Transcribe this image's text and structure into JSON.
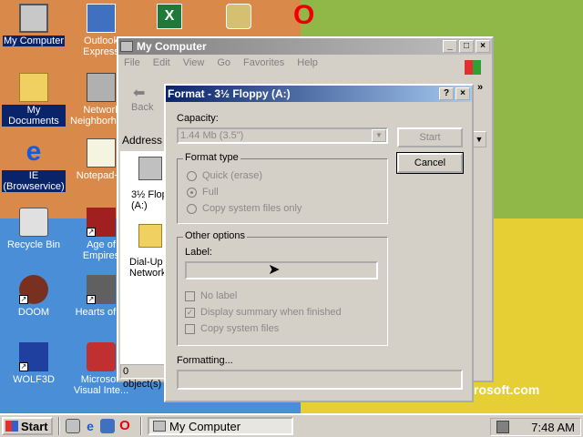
{
  "desktop": {
    "brand_text": "rosoft.com",
    "icons": [
      {
        "label": "My Computer",
        "icon": "computer-icon",
        "selected": true
      },
      {
        "label": "Outlook Express",
        "icon": "outlook-icon"
      },
      {
        "label": "My Documents",
        "icon": "folder-icon",
        "selected": true
      },
      {
        "label": "Network Neighborhood",
        "icon": "network-icon"
      },
      {
        "label": "IE (Browservice)",
        "icon": "internet-explorer-icon",
        "selected": true
      },
      {
        "label": "Notepad++",
        "icon": "notepad-icon"
      },
      {
        "label": "Recycle Bin",
        "icon": "recycle-bin-icon"
      },
      {
        "label": "Age of Empires",
        "icon": "age-of-empires-icon"
      },
      {
        "label": "DOOM",
        "icon": "doom-icon"
      },
      {
        "label": "Hearts of ...",
        "icon": "hearts-of-iron-icon"
      },
      {
        "label": "WOLF3D",
        "icon": "wolf3d-icon"
      },
      {
        "label": "Microsoft Visual Inte...",
        "icon": "visual-interdev-icon"
      }
    ],
    "top_icons": [
      "excel-icon",
      "outlook-express-2-icon",
      "opera-icon"
    ]
  },
  "my_computer": {
    "title": "My Computer",
    "menu": [
      "File",
      "Edit",
      "View",
      "Go",
      "Favorites",
      "Help"
    ],
    "back_label": "Back",
    "address_label": "Address",
    "items": [
      {
        "label": "3½ Flop (A:)",
        "icon": "floppy-drive-icon"
      },
      {
        "label": "Dial-Up Network",
        "icon": "dial-up-networking-icon"
      }
    ],
    "status_text": "0 object(s)"
  },
  "format_dialog": {
    "title": "Format - 3½ Floppy (A:)",
    "capacity_label": "Capacity:",
    "capacity_value": "1.44 Mb (3.5\")",
    "start_label": "Start",
    "cancel_label": "Cancel",
    "format_type": {
      "title": "Format type",
      "options": [
        {
          "label": "Quick (erase)",
          "selected": false
        },
        {
          "label": "Full",
          "selected": true
        },
        {
          "label": "Copy system files only",
          "selected": false
        }
      ]
    },
    "other_options": {
      "title": "Other options",
      "label_label": "Label:",
      "label_value": "",
      "checks": [
        {
          "label": "No label",
          "checked": false
        },
        {
          "label": "Display summary when finished",
          "checked": true
        },
        {
          "label": "Copy system files",
          "checked": false
        }
      ]
    },
    "formatting_label": "Formatting...",
    "progress": 0
  },
  "taskbar": {
    "start_label": "Start",
    "task_label": "My Computer",
    "clock": "7:48 AM",
    "quick_launch": [
      "show-desktop-icon",
      "internet-explorer-icon",
      "channels-icon",
      "opera-icon"
    ]
  }
}
